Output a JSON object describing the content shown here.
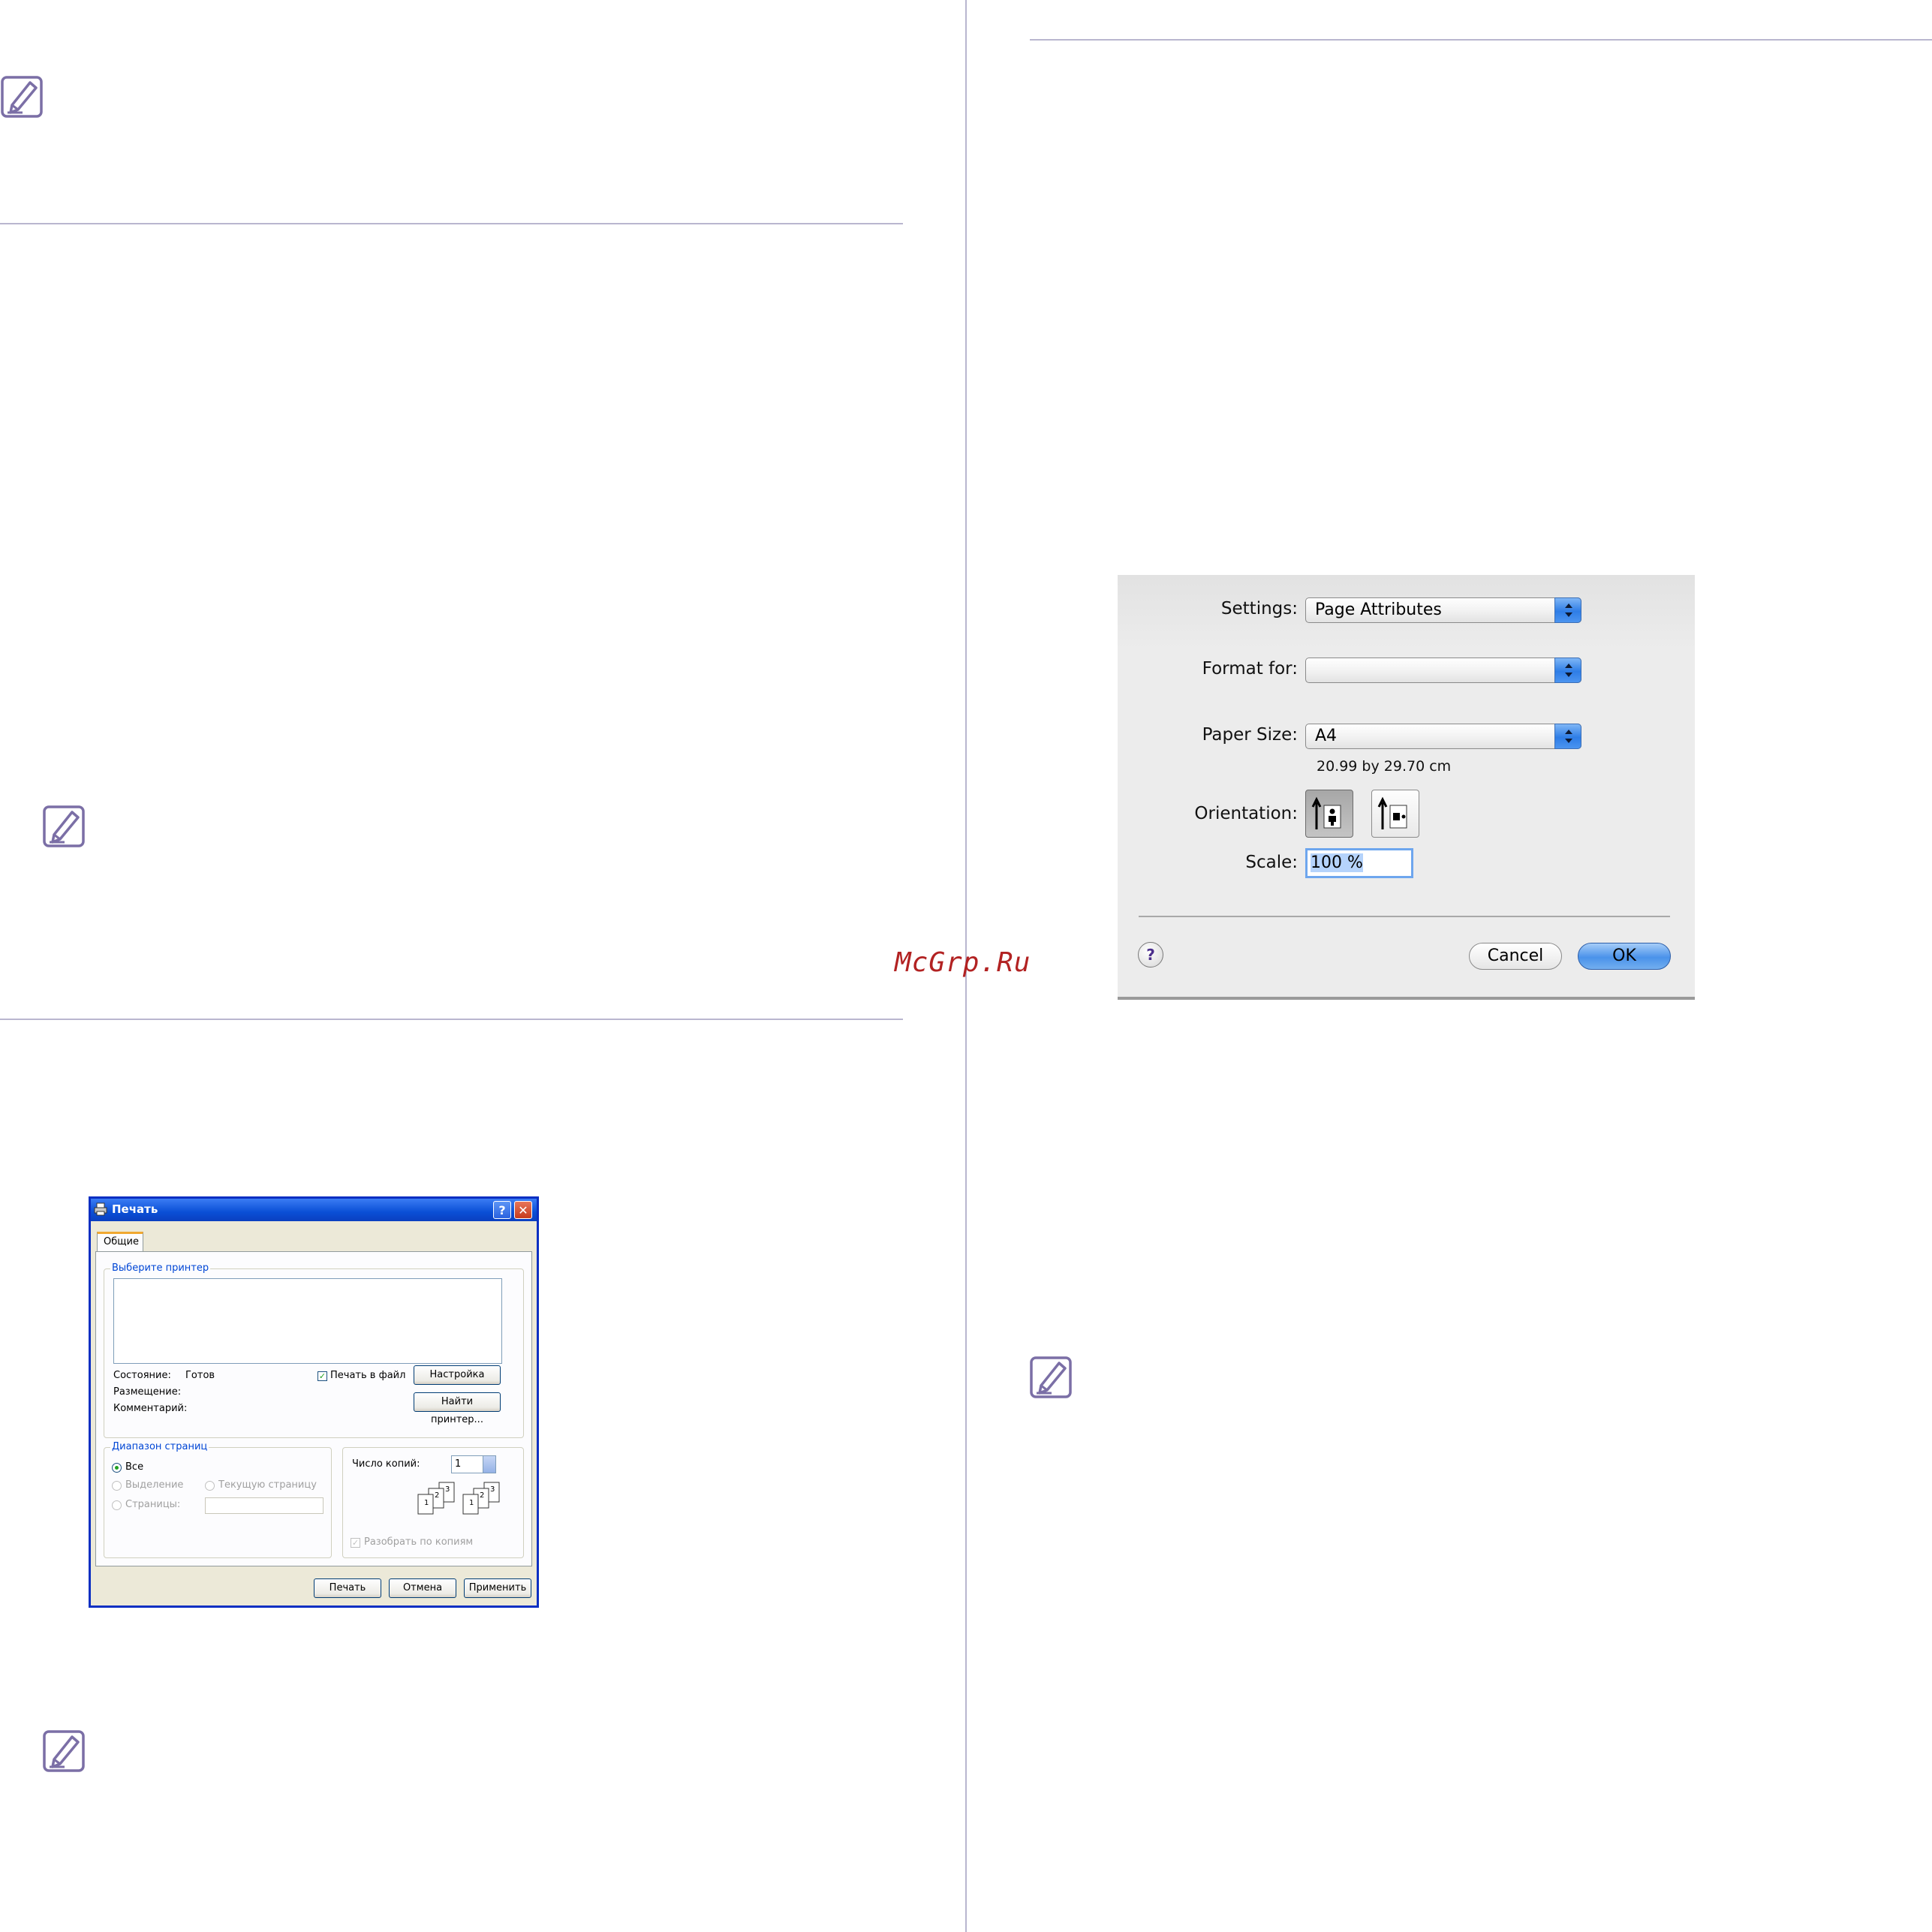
{
  "watermark": "McGrp.Ru",
  "windows_dialog": {
    "title": "Печать",
    "help_button": "?",
    "close_button": "✕",
    "tab_label": "Общие",
    "printer_group": "Выберите принтер",
    "status_label": "Состояние:",
    "status_value": "Готов",
    "location_label": "Размещение:",
    "comment_label": "Комментарий:",
    "print_to_file": "Печать в файл",
    "settings_button": "Настройка",
    "find_printer_button": "Найти принтер...",
    "range_group": "Диапазон страниц",
    "range_all": "Все",
    "range_selection": "Выделение",
    "range_current": "Текущую страницу",
    "range_pages": "Страницы:",
    "copies_label": "Число копий:",
    "copies_value": "1",
    "collate_label": "Разобрать по копиям",
    "print_button": "Печать",
    "cancel_button": "Отмена",
    "apply_button": "Применить"
  },
  "mac_dialog": {
    "settings_label": "Settings:",
    "settings_value": "Page Attributes",
    "format_for_label": "Format for:",
    "format_for_value": "",
    "paper_size_label": "Paper Size:",
    "paper_size_value": "A4",
    "paper_dimensions": "20.99 by 29.70 cm",
    "orientation_label": "Orientation:",
    "orientation_selected": "portrait",
    "scale_label": "Scale:",
    "scale_value": "100 %",
    "help_button": "?",
    "cancel_button": "Cancel",
    "ok_button": "OK"
  },
  "colors": {
    "rule": "#b9b6cf",
    "note_icon": "#7b6fa6",
    "watermark": "#b22222",
    "xp_title": "#0a4fd6",
    "mac_ok": "#4a92ea"
  },
  "icons": [
    "note-icon",
    "printer-icon",
    "help-icon",
    "close-icon",
    "portrait-icon",
    "landscape-icon",
    "collate-icon"
  ]
}
